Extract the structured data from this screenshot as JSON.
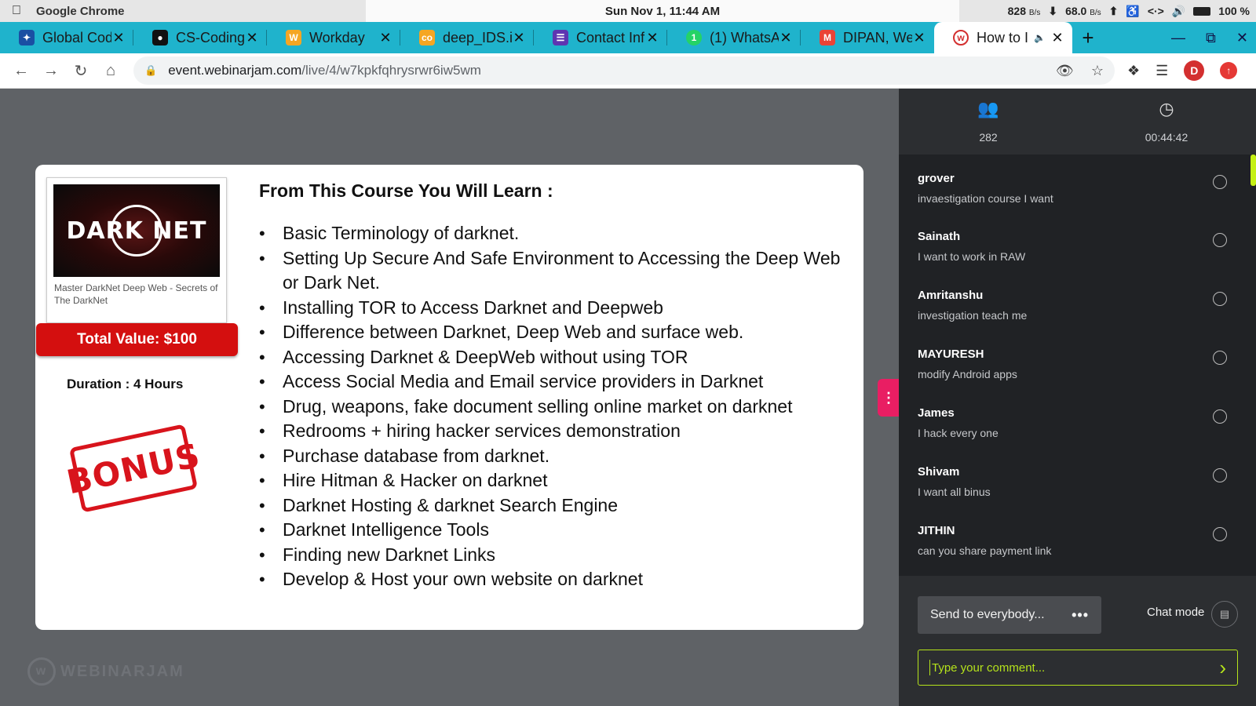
{
  "menubar": {
    "app_name": "Google Chrome",
    "datetime": "Sun Nov  1, 11:44 AM",
    "net_down": "828",
    "net_down_unit": "B/s",
    "net_up": "68.0",
    "net_up_unit": "B/s",
    "battery": "100 %"
  },
  "tabs": [
    {
      "title": "Global Codi",
      "favicon_color": "#1a4fa3",
      "icon": "globe-icon"
    },
    {
      "title": "CS-CodingC",
      "favicon_color": "#111111",
      "icon": "github-icon"
    },
    {
      "title": "Workday",
      "favicon_color": "#f5a623",
      "icon": "workday-icon"
    },
    {
      "title": "deep_IDS.ip",
      "favicon_color": "#f5a623",
      "icon": "colab-icon"
    },
    {
      "title": "Contact Inf",
      "favicon_color": "#5e35b1",
      "icon": "form-icon"
    },
    {
      "title": "(1) WhatsA",
      "favicon_color": "#25d366",
      "icon": "whatsapp-icon"
    },
    {
      "title": "DIPAN, We",
      "favicon_color": "#ea4335",
      "icon": "gmail-icon"
    },
    {
      "title": "How to I",
      "favicon_color": "#d32f2f",
      "icon": "webinarjam-icon",
      "active": true
    }
  ],
  "address": {
    "host": "event.webinarjam.com",
    "path": "/live/4/w7kpkfqhrysrwr6iw5wm"
  },
  "profile_initial": "D",
  "slide": {
    "product_logo": "DARK NET",
    "product_caption": "Master DarkNet Deep Web - Secrets of The DarkNet",
    "total_value": "Total Value: $100",
    "duration": "Duration : 4 Hours",
    "bonus": "BONUS",
    "title": "From This Course You Will Learn :",
    "items": [
      "Basic Terminology of darknet.",
      "Setting Up Secure And Safe Environment to Accessing the Deep Web or Dark Net.",
      "Installing TOR to Access Darknet and Deepweb",
      "Difference between Darknet, Deep Web and surface web.",
      "Accessing Darknet & DeepWeb without using TOR",
      "Access Social Media and Email service providers in Darknet",
      "Drug, weapons, fake document selling online market on darknet",
      "Redrooms + hiring hacker services demonstration",
      "Purchase database from darknet.",
      "Hire Hitman & Hacker on darknet",
      "Darknet Hosting & darknet Search Engine",
      "Darknet Intelligence Tools",
      "Finding new Darknet Links",
      "Develop & Host your own website on darknet"
    ]
  },
  "branding": "WEBINARJAM",
  "chat": {
    "viewers": "282",
    "elapsed": "00:44:42",
    "messages": [
      {
        "name": "grover",
        "text": "invaestigation course I want"
      },
      {
        "name": "Sainath",
        "text": "I want to work in RAW"
      },
      {
        "name": "Amritanshu",
        "text": "investigation teach me"
      },
      {
        "name": "MAYURESH",
        "text": "modify Android apps"
      },
      {
        "name": "James",
        "text": "I hack every one"
      },
      {
        "name": "Shivam",
        "text": "I want all binus"
      },
      {
        "name": "JITHIN",
        "text": "can you share payment link"
      }
    ],
    "send_to": "Send to everybody...",
    "chat_mode": "Chat mode",
    "comment_placeholder": "Type your comment..."
  },
  "colors": {
    "tab_strip": "#1fb3cc",
    "accent_red": "#d40f0f",
    "chat_accent": "#b5e31b",
    "handle_pink": "#e91e63"
  }
}
